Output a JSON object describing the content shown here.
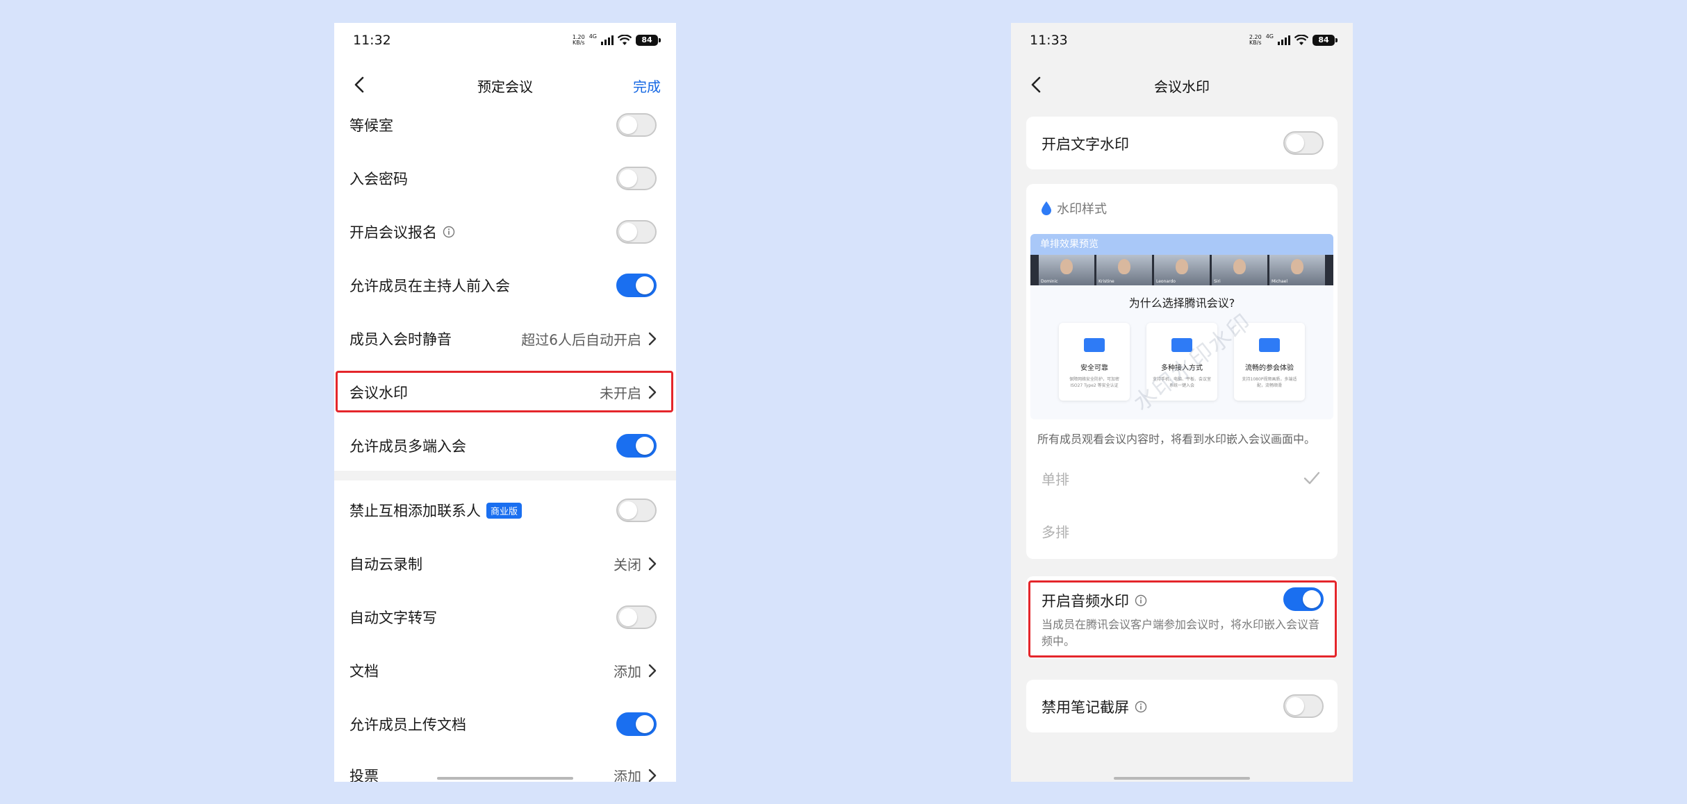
{
  "left_screen": {
    "status_bar": {
      "time": "11:32",
      "net_speed_value": "1.20",
      "net_speed_unit": "KB/s",
      "network": "4G",
      "battery": "84"
    },
    "nav": {
      "title": "预定会议",
      "done_label": "完成"
    },
    "rows": [
      {
        "label": "等候室",
        "toggle": "off"
      },
      {
        "label": "入会密码",
        "toggle": "off"
      },
      {
        "label": "开启会议报名",
        "toggle": "off",
        "info_icon": true
      },
      {
        "label": "允许成员在主持人前入会",
        "toggle": "on"
      },
      {
        "label": "成员入会时静音",
        "value": "超过6人后自动开启"
      },
      {
        "label": "会议水印",
        "value": "未开启",
        "highlighted": true
      },
      {
        "label": "允许成员多端入会",
        "toggle": "on"
      },
      {
        "label": "禁止互相添加联系人",
        "toggle": "off",
        "badge": "商业版"
      },
      {
        "label": "自动云录制",
        "value": "关闭"
      },
      {
        "label": "自动文字转写",
        "toggle": "off"
      },
      {
        "label": "文档",
        "value": "添加"
      },
      {
        "label": "允许成员上传文档",
        "toggle": "on"
      },
      {
        "label": "投票",
        "value": "添加"
      }
    ]
  },
  "right_screen": {
    "status_bar": {
      "time": "11:33",
      "net_speed_value": "2.20",
      "net_speed_unit": "KB/s",
      "network": "4G",
      "battery": "84"
    },
    "nav": {
      "title": "会议水印"
    },
    "text_watermark": {
      "label": "开启文字水印",
      "toggle": "off"
    },
    "style_section": {
      "title": "水印样式",
      "preview_header": "单排效果预览",
      "preview_question": "为什么选择腾讯会议?",
      "preview_watermark": "水印水印水印",
      "video_names": [
        "Dominic",
        "Kristine",
        "Leonardo",
        "Siri",
        "Michael"
      ],
      "features": [
        {
          "title": "安全可靠",
          "desc": "保障网络安全防护，可加密 ISO27 Type2 等安全认证"
        },
        {
          "title": "多种接入方式",
          "desc": "支持手机、电脑、平板、会议室系统一键入会"
        },
        {
          "title": "流畅的参会体验",
          "desc": "支持1080P视频画质，多端适配，流畅顺滑"
        }
      ],
      "description": "所有成员观看会议内容时，将看到水印嵌入会议画面中。",
      "options": [
        {
          "label": "单排",
          "selected": true
        },
        {
          "label": "多排",
          "selected": false
        }
      ]
    },
    "audio_watermark": {
      "label": "开启音频水印",
      "toggle": "on",
      "description": "当成员在腾讯会议客户端参加会议时，将水印嵌入会议音频中。"
    },
    "note_screenshot": {
      "label": "禁用笔记截屏",
      "toggle": "off"
    }
  },
  "colors": {
    "background": "#d7e3fb",
    "accent_blue": "#1a6ff0",
    "highlight_red": "#e4262b"
  }
}
